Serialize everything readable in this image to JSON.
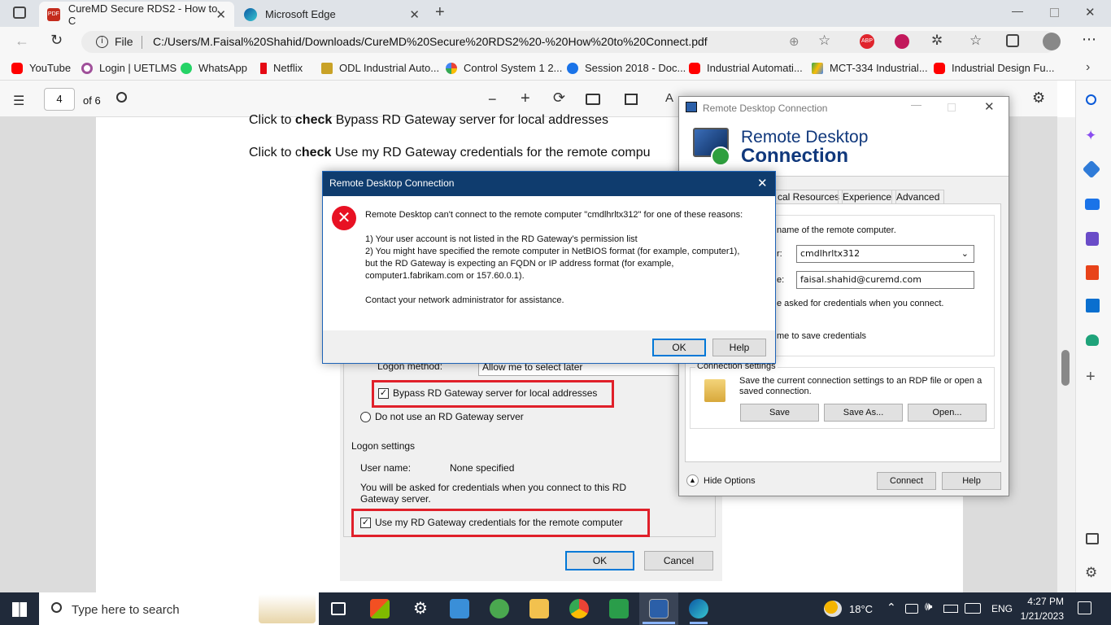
{
  "browser": {
    "tabs": [
      {
        "label": "CureMD Secure RDS2 - How to C",
        "icon": "pdf-icon"
      },
      {
        "label": "Microsoft Edge",
        "icon": "edge-icon"
      }
    ],
    "address": {
      "prefix": "File",
      "url": "C:/Users/M.Faisal%20Shahid/Downloads/CureMD%20Secure%20RDS2%20-%20How%20to%20Connect.pdf"
    },
    "bookmarks": [
      {
        "label": "YouTube",
        "color": "#ff0000"
      },
      {
        "label": "Login | UETLMS",
        "color": "#a0509a"
      },
      {
        "label": "WhatsApp",
        "color": "#25d366"
      },
      {
        "label": "Netflix",
        "color": "#e50914"
      },
      {
        "label": "ODL Industrial Auto...",
        "color": "#c9a227"
      },
      {
        "label": "Control System 1 2...",
        "color": "#4285f4"
      },
      {
        "label": "Session 2018 - Doc...",
        "color": "#1a73e8"
      },
      {
        "label": "Industrial Automati...",
        "color": "#ff0000"
      },
      {
        "label": "MCT-334 Industrial...",
        "color": "#fbbc04"
      },
      {
        "label": "Industrial Design Fu...",
        "color": "#ff0000"
      }
    ]
  },
  "pdf": {
    "page_number": "4",
    "page_total": "of 6",
    "line1_prefix": "Click to ",
    "line1_bold": "check",
    "line1_rest": " Bypass RD Gateway server for local addresses",
    "line2_prefix": "Click to c",
    "line2_bold": "heck",
    "line2_rest": " Use my RD Gateway credentials for the remote compu",
    "screenshot": {
      "logon_method_label": "Logon method:",
      "logon_method_value": "Allow me to select later",
      "bypass_label": "Bypass RD Gateway server for local addresses",
      "no_gateway_label": "Do not use an RD Gateway server",
      "logon_settings": "Logon settings",
      "user_name_label": "User name:",
      "user_name_value": "None specified",
      "ask_note": "You will be asked for credentials when you connect to this RD Gateway server.",
      "use_creds_label": "Use my RD Gateway credentials for the remote computer",
      "ok": "OK",
      "cancel": "Cancel"
    }
  },
  "rdc": {
    "title": "Remote Desktop Connection",
    "banner_line1": "Remote Desktop",
    "banner_line2": "Connection",
    "tabs": [
      "cal Resources",
      "Experience",
      "Advanced"
    ],
    "hint": "name of the remote computer.",
    "computer_label": "r:",
    "computer_value": "cmdlhrltx312",
    "user_label": "e:",
    "user_value": "faisal.shahid@curemd.com",
    "ask_text": "e asked for credentials when you connect.",
    "save_creds": "me to save credentials",
    "conn_settings_title": "Connection settings",
    "conn_settings_text": "Save the current connection settings to an RDP file or open a saved connection.",
    "save": "Save",
    "save_as": "Save As...",
    "open": "Open...",
    "hide_options": "Hide Options",
    "connect": "Connect",
    "help": "Help"
  },
  "error_dialog": {
    "title": "Remote Desktop Connection",
    "message_intro": "Remote Desktop can't connect to the remote computer \"cmdlhrltx312\" for one of these reasons:",
    "reason1": "1) Your user account is not listed in the RD Gateway's permission list",
    "reason2": "2) You might have specified the remote computer in NetBIOS format (for example, computer1), but the RD Gateway is expecting an FQDN or IP address format (for example, computer1.fabrikam.com or 157.60.0.1).",
    "contact": "Contact your network administrator for assistance.",
    "ok": "OK",
    "help": "Help"
  },
  "taskbar": {
    "search_placeholder": "Type here to search",
    "weather": "18°C",
    "lang": "ENG",
    "time": "4:27 PM",
    "date": "1/21/2023"
  }
}
